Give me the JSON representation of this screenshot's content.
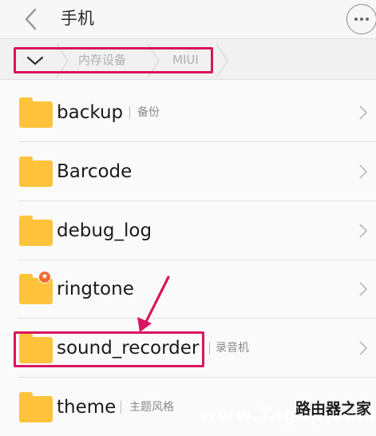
{
  "header": {
    "title": "手机",
    "back_icon": "chevron-left-icon",
    "more_icon": "more-horizontal-icon"
  },
  "breadcrumb": {
    "toggle_icon": "chevron-down-icon",
    "items": [
      "内存设备",
      "MIUI"
    ]
  },
  "folders": [
    {
      "name": "backup",
      "subtitle": "备份",
      "badge": false
    },
    {
      "name": "Barcode",
      "subtitle": "",
      "badge": false
    },
    {
      "name": "debug_log",
      "subtitle": "",
      "badge": false
    },
    {
      "name": "ringtone",
      "subtitle": "",
      "badge": true
    },
    {
      "name": "sound_recorder",
      "subtitle": "录音机",
      "badge": false
    },
    {
      "name": "theme",
      "subtitle": "主题风格",
      "badge": false
    }
  ],
  "colors": {
    "folder": "#ffc33b",
    "highlight": "#d8155e",
    "badge": "#ef6a2f"
  },
  "watermark": {
    "text": "www.Tagxp.com",
    "cn": "路由器之家"
  }
}
